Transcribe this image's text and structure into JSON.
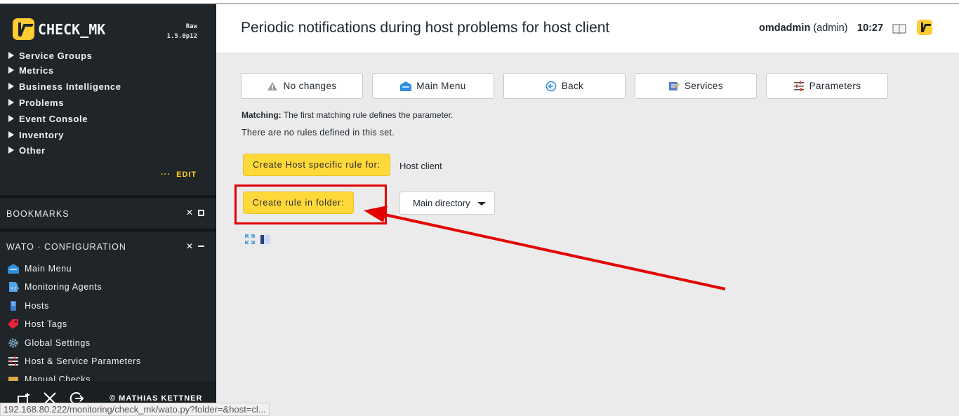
{
  "sidebar": {
    "brand": "CHECK_MK",
    "edition_line1": "Raw",
    "edition_line2": "1.5.0p12",
    "views": [
      {
        "label": "Service Groups"
      },
      {
        "label": "Metrics"
      },
      {
        "label": "Business Intelligence"
      },
      {
        "label": "Problems"
      },
      {
        "label": "Event Console"
      },
      {
        "label": "Inventory"
      },
      {
        "label": "Other"
      }
    ],
    "edit_label": "EDIT",
    "bookmarks_title": "BOOKMARKS",
    "wato_title": "WATO · CONFIGURATION",
    "wato_items": [
      {
        "label": "Main Menu",
        "icon": "main-menu-icon"
      },
      {
        "label": "Monitoring Agents",
        "icon": "agents-icon"
      },
      {
        "label": "Hosts",
        "icon": "hosts-icon"
      },
      {
        "label": "Host Tags",
        "icon": "tag-icon"
      },
      {
        "label": "Global Settings",
        "icon": "gear-icon"
      },
      {
        "label": "Host & Service Parameters",
        "icon": "parameters-icon"
      },
      {
        "label": "Manual Checks",
        "icon": "manual-checks-icon"
      }
    ],
    "copyright": "© MATHIAS KETTNER"
  },
  "header": {
    "title": "Periodic notifications during host problems for host client",
    "user": "omdadmin",
    "role": "(admin)",
    "time": "10:27"
  },
  "toolbar": {
    "no_changes": "No changes",
    "main_menu": "Main Menu",
    "back": "Back",
    "services": "Services",
    "parameters": "Parameters"
  },
  "content": {
    "matching_label": "Matching:",
    "matching_text": "The first matching rule defines the parameter.",
    "no_rules": "There are no rules defined in this set.",
    "create_host_rule": "Create Host specific rule for:",
    "host_name": "Host client",
    "create_folder_rule": "Create rule in folder:",
    "folder_selected": "Main directory"
  },
  "statusbar": {
    "url": "192.168.80.222/monitoring/check_mk/wato.py?folder=&host=cl..."
  },
  "colors": {
    "accent": "#ffd83a",
    "sidebar_bg": "#1f2528",
    "annotation": "#e30000"
  }
}
